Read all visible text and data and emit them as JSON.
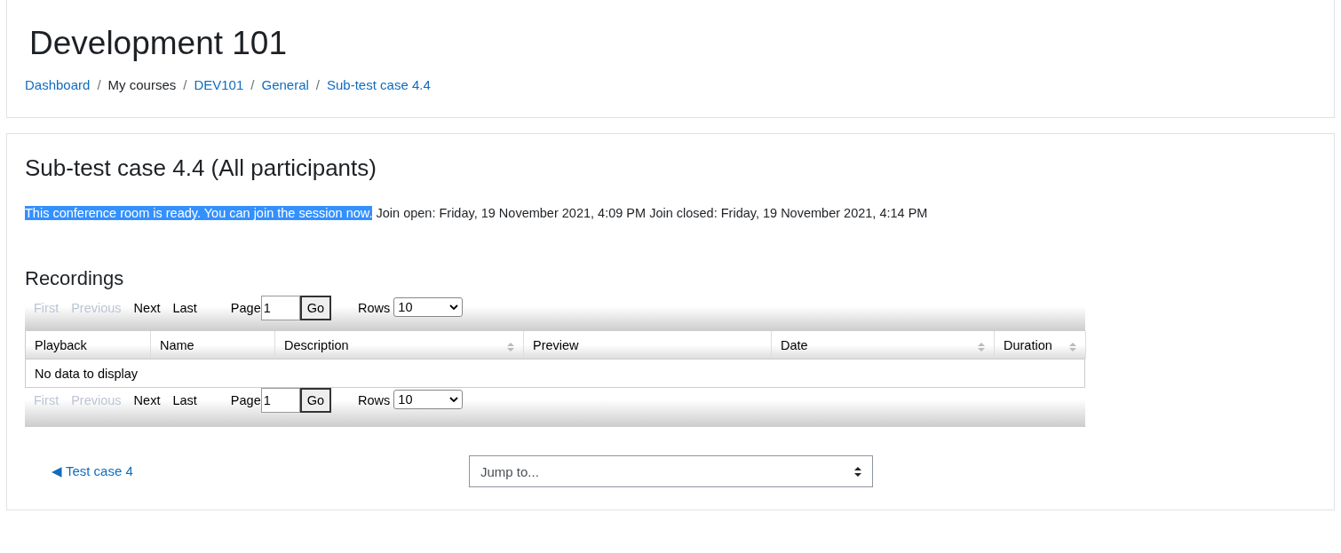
{
  "header": {
    "title": "Development 101",
    "separator": "/",
    "breadcrumb": [
      {
        "label": "Dashboard",
        "kind": "link"
      },
      {
        "label": "My courses",
        "kind": "text"
      },
      {
        "label": "DEV101",
        "kind": "link"
      },
      {
        "label": "General",
        "kind": "link"
      },
      {
        "label": "Sub-test case 4.4",
        "kind": "link"
      }
    ]
  },
  "main": {
    "title": "Sub-test case 4.4 (All participants)",
    "status": {
      "text": "This conference room is ready. You can join the session now.",
      "highlighted": true
    },
    "join_open": "Join open: Friday, 19 November 2021, 4:09 PM",
    "join_closed": "Join closed: Friday, 19 November 2021, 4:14 PM",
    "recordings": {
      "title": "Recordings",
      "pagers": [
        {
          "links": [
            {
              "label": "First",
              "disabled": true
            },
            {
              "label": "Previous",
              "disabled": true
            },
            {
              "label": "Next",
              "disabled": false
            },
            {
              "label": "Last",
              "disabled": false
            }
          ],
          "page_label": "Page",
          "page": "1",
          "go": "Go",
          "rows_label": "Rows",
          "rows": "10"
        },
        {
          "links": [
            {
              "label": "First",
              "disabled": true
            },
            {
              "label": "Previous",
              "disabled": true
            },
            {
              "label": "Next",
              "disabled": false
            },
            {
              "label": "Last",
              "disabled": false
            }
          ],
          "page_label": "Page",
          "page": "1",
          "go": "Go",
          "rows_label": "Rows",
          "rows": "10"
        }
      ],
      "columns": [
        {
          "label": "Playback",
          "sortable": false
        },
        {
          "label": "Name",
          "sortable": false
        },
        {
          "label": "Description",
          "sortable": true
        },
        {
          "label": "Preview",
          "sortable": false
        },
        {
          "label": "Date",
          "sortable": true
        },
        {
          "label": "Duration",
          "sortable": true
        }
      ],
      "empty": "No data to display"
    },
    "prev_link": "◀ Test case 4",
    "jump": {
      "value": "Jump to..."
    }
  }
}
